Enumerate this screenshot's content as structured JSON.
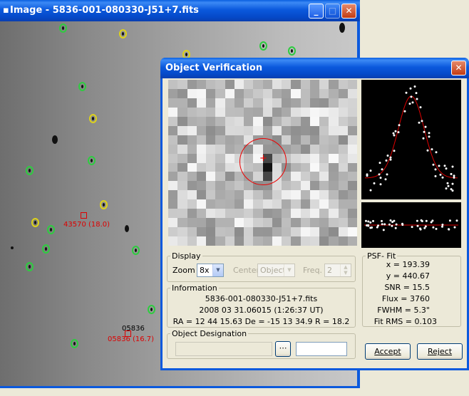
{
  "image_window": {
    "title": "Image - 5836-001-080330-J51+7.fits",
    "annotations": [
      {
        "text": "43570 (18.0)",
        "color": "red"
      },
      {
        "text": "05836",
        "color": "black"
      },
      {
        "text": "05836 (16.7)",
        "color": "red"
      }
    ]
  },
  "dialog": {
    "title": "Object Verification",
    "display": {
      "legend": "Display",
      "zoom_label": "Zoom",
      "zoom_value": "8x",
      "center_label": "Center",
      "center_value": "Object",
      "freq_label": "Freq.",
      "freq_value": "2"
    },
    "information": {
      "legend": "Information",
      "file": "5836-001-080330-J51+7.fits",
      "datetime": "2008 03 31.06015 (1:26:37 UT)",
      "coords": "RA = 12 44 15.63   De = -15 13 34.9   R = 18.2"
    },
    "designation": {
      "legend": "Object Designation",
      "input_value": "",
      "second_value": ""
    },
    "psf": {
      "legend": "PSF- Fit",
      "x": "x = 193.39",
      "y": "y = 440.67",
      "snr": "SNR = 15.5",
      "flux": "Flux = 3760",
      "fwhm": "FWHM = 5.3\"",
      "fit_rms": "Fit RMS = 0.103"
    },
    "buttons": {
      "accept": "Accept",
      "reject": "Reject"
    }
  },
  "colors": {
    "title_blue": "#0b59dd",
    "annotation_red": "#d00000",
    "ring_green": "#2ecc40",
    "ring_yellow": "#ddd21a",
    "fit_curve": "#e00000"
  }
}
